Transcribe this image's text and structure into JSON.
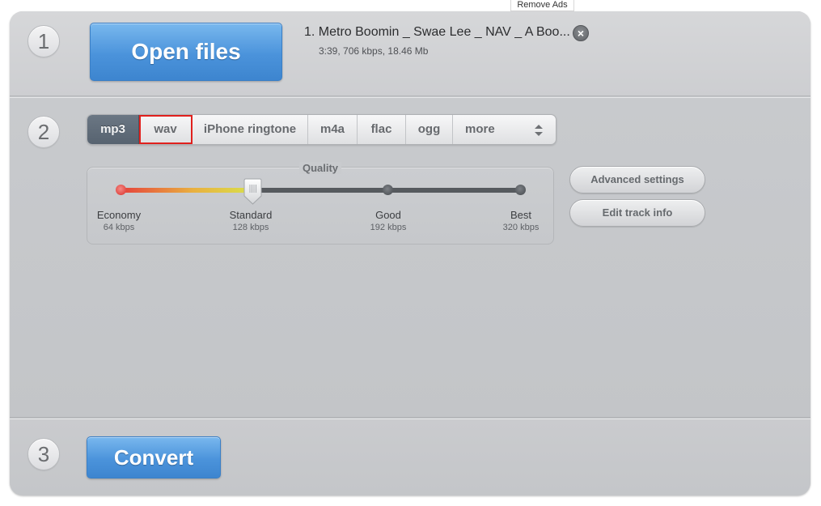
{
  "top": {
    "remove_ads": "Remove Ads"
  },
  "step1": {
    "number": "1",
    "open_files_label": "Open files",
    "file": {
      "title": "1. Metro Boomin _ Swae Lee _ NAV _ A Boo...",
      "meta": "3:39, 706 kbps, 18.46 Mb",
      "remove_icon": "close-circle-icon"
    }
  },
  "step2": {
    "number": "2",
    "formats": [
      {
        "label": "mp3",
        "active": true
      },
      {
        "label": "wav",
        "highlighted": true
      },
      {
        "label": "iPhone ringtone"
      },
      {
        "label": "m4a"
      },
      {
        "label": "flac"
      },
      {
        "label": "ogg"
      },
      {
        "label": "more",
        "icon": "up-down-arrows-icon"
      }
    ],
    "quality": {
      "title": "Quality",
      "selected_index": 1,
      "levels": [
        {
          "name": "Economy",
          "kbps": "64 kbps"
        },
        {
          "name": "Standard",
          "kbps": "128 kbps"
        },
        {
          "name": "Good",
          "kbps": "192 kbps"
        },
        {
          "name": "Best",
          "kbps": "320 kbps"
        }
      ]
    },
    "advanced_settings_label": "Advanced settings",
    "edit_track_info_label": "Edit track info"
  },
  "step3": {
    "number": "3",
    "convert_label": "Convert"
  },
  "colors": {
    "accent_blue": "#4b93db",
    "active_format": "#5f6b78",
    "highlight_outline": "#e0201d",
    "slider_fill_start": "#e6413c",
    "slider_fill_end": "#d8e04a"
  }
}
